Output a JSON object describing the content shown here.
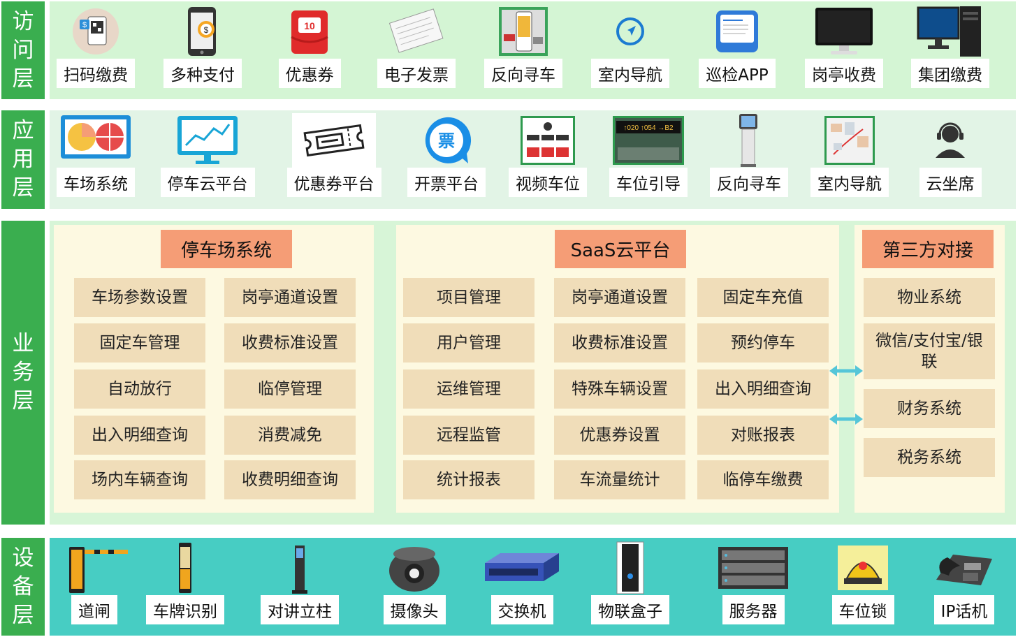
{
  "layers": {
    "access": "访问层",
    "application": "应用层",
    "business": "业务层",
    "device": "设备层"
  },
  "access_items": [
    {
      "label": "扫码缴费",
      "icon": "qr-payment-icon"
    },
    {
      "label": "多种支付",
      "icon": "mobile-payment-icon"
    },
    {
      "label": "优惠券",
      "icon": "coupon-icon"
    },
    {
      "label": "电子发票",
      "icon": "invoice-icon"
    },
    {
      "label": "反向寻车",
      "icon": "find-car-phone-icon"
    },
    {
      "label": "室内导航",
      "icon": "navigation-icon"
    },
    {
      "label": "巡检APP",
      "icon": "inspection-app-icon"
    },
    {
      "label": "岗亭收费",
      "icon": "monitor-icon"
    },
    {
      "label": "集团缴费",
      "icon": "desktop-computer-icon"
    }
  ],
  "app_items": [
    {
      "label": "车场系统",
      "icon": "pie-chart-screen-icon"
    },
    {
      "label": "停车云平台",
      "icon": "line-chart-screen-icon"
    },
    {
      "label": "优惠券平台",
      "icon": "ticket-icon"
    },
    {
      "label": "开票平台",
      "icon": "invoice-bubble-icon",
      "glyph": "票"
    },
    {
      "label": "视频车位",
      "icon": "video-parking-icon"
    },
    {
      "label": "车位引导",
      "icon": "parking-guidance-icon",
      "sign": "↑020 ↑054 →B2"
    },
    {
      "label": "反向寻车",
      "icon": "kiosk-icon"
    },
    {
      "label": "室内导航",
      "icon": "indoor-map-icon"
    },
    {
      "label": "云坐席",
      "icon": "headset-agent-icon"
    }
  ],
  "business": {
    "parking_system": {
      "title": "停车场系统",
      "modules": [
        "车场参数设置",
        "岗亭通道设置",
        "固定车管理",
        "收费标准设置",
        "自动放行",
        "临停管理",
        "出入明细查询",
        "消费减免",
        "场内车辆查询",
        "收费明细查询"
      ]
    },
    "saas_platform": {
      "title": "SaaS云平台",
      "modules": [
        "项目管理",
        "岗亭通道设置",
        "固定车充值",
        "用户管理",
        "收费标准设置",
        "预约停车",
        "运维管理",
        "特殊车辆设置",
        "出入明细查询",
        "远程监管",
        "优惠券设置",
        "对账报表",
        "统计报表",
        "车流量统计",
        "临停车缴费"
      ]
    },
    "third_party": {
      "title": "第三方对接",
      "modules": [
        "物业系统",
        "微信/支付宝/银联",
        "财务系统",
        "税务系统"
      ]
    }
  },
  "device_items": [
    {
      "label": "道闸",
      "icon": "barrier-gate-icon"
    },
    {
      "label": "车牌识别",
      "icon": "plate-recognition-icon"
    },
    {
      "label": "对讲立柱",
      "icon": "intercom-pillar-icon"
    },
    {
      "label": "摄像头",
      "icon": "dome-camera-icon"
    },
    {
      "label": "交换机",
      "icon": "network-switch-icon"
    },
    {
      "label": "物联盒子",
      "icon": "iot-box-icon"
    },
    {
      "label": "服务器",
      "icon": "server-rack-icon"
    },
    {
      "label": "车位锁",
      "icon": "parking-lock-icon"
    },
    {
      "label": "IP话机",
      "icon": "ip-phone-icon"
    }
  ],
  "colors": {
    "layer_label": "#3aae4f",
    "access_bg": "#d4f5d4",
    "device_bg": "#47cdc3",
    "group_title": "#f59d76",
    "module": "#f0ddb9",
    "group_bg": "#fdf9e1",
    "arrow": "#55c6d8"
  }
}
